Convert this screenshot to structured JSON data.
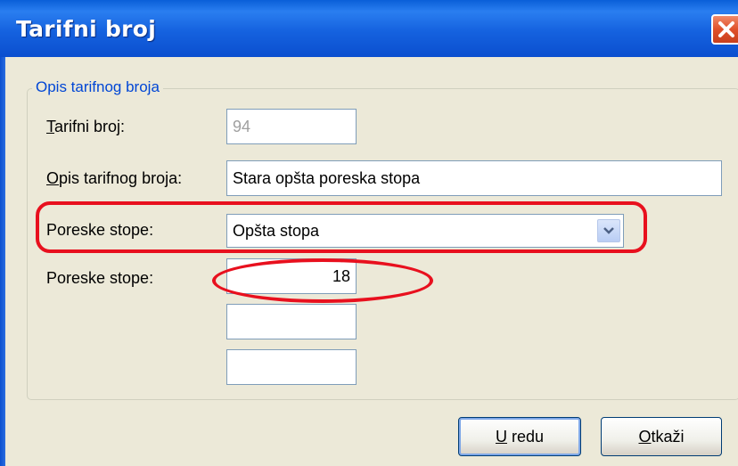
{
  "window": {
    "title": "Tarifni broj",
    "close_icon": "close-icon"
  },
  "group": {
    "legend": "Opis tarifnog broja"
  },
  "form": {
    "tarifni_broj_label_mnemonic": "T",
    "tarifni_broj_label_rest": "arifni broj:",
    "tarifni_broj_value": "94",
    "opis_label_mnemonic": "O",
    "opis_label_rest": "pis tarifnog broja:",
    "opis_value": "Stara opšta poreska stopa",
    "poreske_stope_select_label": "Poreske stope:",
    "poreske_stope_selected": "Opšta stopa",
    "poreske_stope_rate_label": "Poreske stope:",
    "rate_1": "18",
    "rate_2": "",
    "rate_3": ""
  },
  "buttons": {
    "ok_mnemonic": "U",
    "ok_rest": " redu",
    "cancel_mnemonic": "O",
    "cancel_rest": "tkaži"
  },
  "colors": {
    "titlebar": "#1562df",
    "client_bg": "#ece9d8",
    "legend_text": "#0046d5",
    "highlight": "#e8101e",
    "close_button": "#e0502a"
  }
}
